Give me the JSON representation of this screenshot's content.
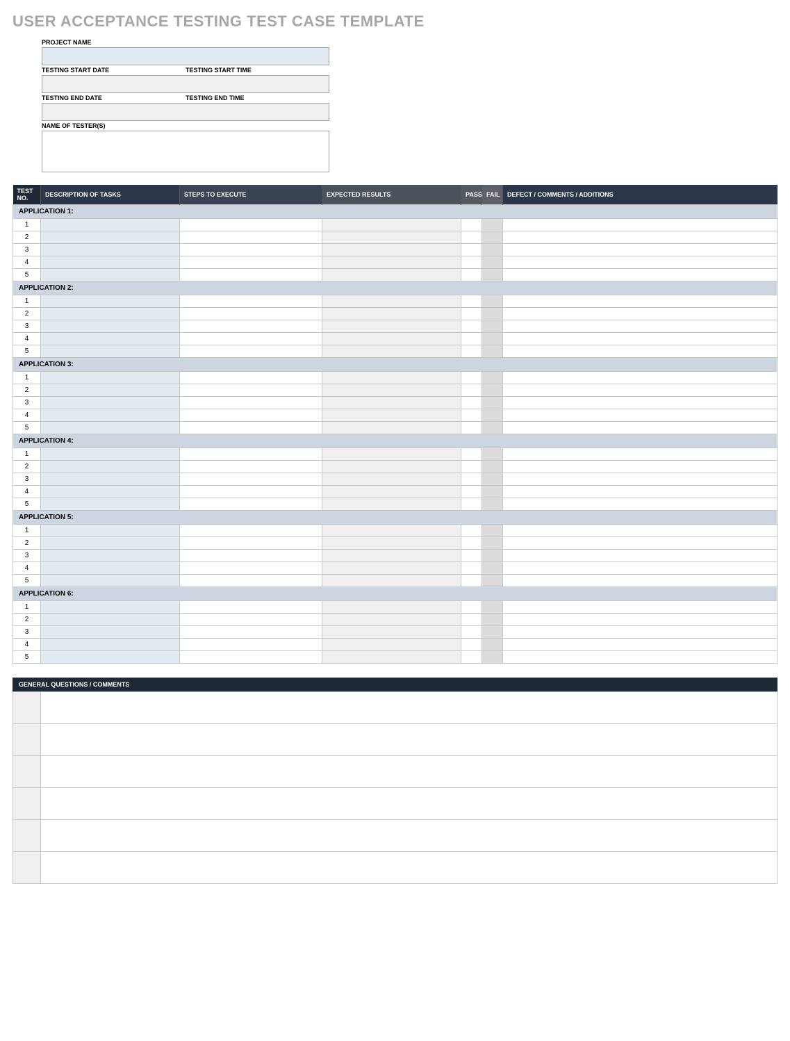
{
  "title": "USER ACCEPTANCE TESTING TEST CASE TEMPLATE",
  "meta": {
    "projectNameLabel": "PROJECT NAME",
    "startDateLabel": "TESTING START DATE",
    "startTimeLabel": "TESTING START TIME",
    "endDateLabel": "TESTING END DATE",
    "endTimeLabel": "TESTING END TIME",
    "testersLabel": "NAME OF TESTER(S)",
    "projectName": "",
    "startDate": "",
    "startTime": "",
    "endDate": "",
    "endTime": "",
    "testers": ""
  },
  "columns": {
    "testNo": "TEST NO.",
    "desc": "DESCRIPTION OF TASKS",
    "steps": "STEPS TO EXECUTE",
    "expected": "EXPECTED RESULTS",
    "pass": "PASS",
    "fail": "FAIL",
    "defect": "DEFECT / COMMENTS / ADDITIONS"
  },
  "applications": [
    {
      "label": "APPLICATION 1:",
      "rows": [
        {
          "no": "1",
          "desc": "",
          "steps": "",
          "expected": "",
          "pass": "",
          "fail": "",
          "defect": ""
        },
        {
          "no": "2",
          "desc": "",
          "steps": "",
          "expected": "",
          "pass": "",
          "fail": "",
          "defect": ""
        },
        {
          "no": "3",
          "desc": "",
          "steps": "",
          "expected": "",
          "pass": "",
          "fail": "",
          "defect": ""
        },
        {
          "no": "4",
          "desc": "",
          "steps": "",
          "expected": "",
          "pass": "",
          "fail": "",
          "defect": ""
        },
        {
          "no": "5",
          "desc": "",
          "steps": "",
          "expected": "",
          "pass": "",
          "fail": "",
          "defect": ""
        }
      ]
    },
    {
      "label": "APPLICATION 2:",
      "rows": [
        {
          "no": "1",
          "desc": "",
          "steps": "",
          "expected": "",
          "pass": "",
          "fail": "",
          "defect": ""
        },
        {
          "no": "2",
          "desc": "",
          "steps": "",
          "expected": "",
          "pass": "",
          "fail": "",
          "defect": ""
        },
        {
          "no": "3",
          "desc": "",
          "steps": "",
          "expected": "",
          "pass": "",
          "fail": "",
          "defect": ""
        },
        {
          "no": "4",
          "desc": "",
          "steps": "",
          "expected": "",
          "pass": "",
          "fail": "",
          "defect": ""
        },
        {
          "no": "5",
          "desc": "",
          "steps": "",
          "expected": "",
          "pass": "",
          "fail": "",
          "defect": ""
        }
      ]
    },
    {
      "label": "APPLICATION 3:",
      "rows": [
        {
          "no": "1",
          "desc": "",
          "steps": "",
          "expected": "",
          "pass": "",
          "fail": "",
          "defect": ""
        },
        {
          "no": "2",
          "desc": "",
          "steps": "",
          "expected": "",
          "pass": "",
          "fail": "",
          "defect": ""
        },
        {
          "no": "3",
          "desc": "",
          "steps": "",
          "expected": "",
          "pass": "",
          "fail": "",
          "defect": ""
        },
        {
          "no": "4",
          "desc": "",
          "steps": "",
          "expected": "",
          "pass": "",
          "fail": "",
          "defect": ""
        },
        {
          "no": "5",
          "desc": "",
          "steps": "",
          "expected": "",
          "pass": "",
          "fail": "",
          "defect": ""
        }
      ]
    },
    {
      "label": "APPLICATION 4:",
      "rows": [
        {
          "no": "1",
          "desc": "",
          "steps": "",
          "expected": "",
          "pass": "",
          "fail": "",
          "defect": ""
        },
        {
          "no": "2",
          "desc": "",
          "steps": "",
          "expected": "",
          "pass": "",
          "fail": "",
          "defect": ""
        },
        {
          "no": "3",
          "desc": "",
          "steps": "",
          "expected": "",
          "pass": "",
          "fail": "",
          "defect": ""
        },
        {
          "no": "4",
          "desc": "",
          "steps": "",
          "expected": "",
          "pass": "",
          "fail": "",
          "defect": ""
        },
        {
          "no": "5",
          "desc": "",
          "steps": "",
          "expected": "",
          "pass": "",
          "fail": "",
          "defect": ""
        }
      ]
    },
    {
      "label": "APPLICATION 5:",
      "rows": [
        {
          "no": "1",
          "desc": "",
          "steps": "",
          "expected": "",
          "pass": "",
          "fail": "",
          "defect": ""
        },
        {
          "no": "2",
          "desc": "",
          "steps": "",
          "expected": "",
          "pass": "",
          "fail": "",
          "defect": ""
        },
        {
          "no": "3",
          "desc": "",
          "steps": "",
          "expected": "",
          "pass": "",
          "fail": "",
          "defect": ""
        },
        {
          "no": "4",
          "desc": "",
          "steps": "",
          "expected": "",
          "pass": "",
          "fail": "",
          "defect": ""
        },
        {
          "no": "5",
          "desc": "",
          "steps": "",
          "expected": "",
          "pass": "",
          "fail": "",
          "defect": ""
        }
      ]
    },
    {
      "label": "APPLICATION 6:",
      "rows": [
        {
          "no": "1",
          "desc": "",
          "steps": "",
          "expected": "",
          "pass": "",
          "fail": "",
          "defect": ""
        },
        {
          "no": "2",
          "desc": "",
          "steps": "",
          "expected": "",
          "pass": "",
          "fail": "",
          "defect": ""
        },
        {
          "no": "3",
          "desc": "",
          "steps": "",
          "expected": "",
          "pass": "",
          "fail": "",
          "defect": ""
        },
        {
          "no": "4",
          "desc": "",
          "steps": "",
          "expected": "",
          "pass": "",
          "fail": "",
          "defect": ""
        },
        {
          "no": "5",
          "desc": "",
          "steps": "",
          "expected": "",
          "pass": "",
          "fail": "",
          "defect": ""
        }
      ]
    }
  ],
  "gqcHeader": "GENERAL QUESTIONS / COMMENTS",
  "gqcRows": [
    {
      "num": "",
      "text": ""
    },
    {
      "num": "",
      "text": ""
    },
    {
      "num": "",
      "text": ""
    },
    {
      "num": "",
      "text": ""
    },
    {
      "num": "",
      "text": ""
    },
    {
      "num": "",
      "text": ""
    }
  ]
}
